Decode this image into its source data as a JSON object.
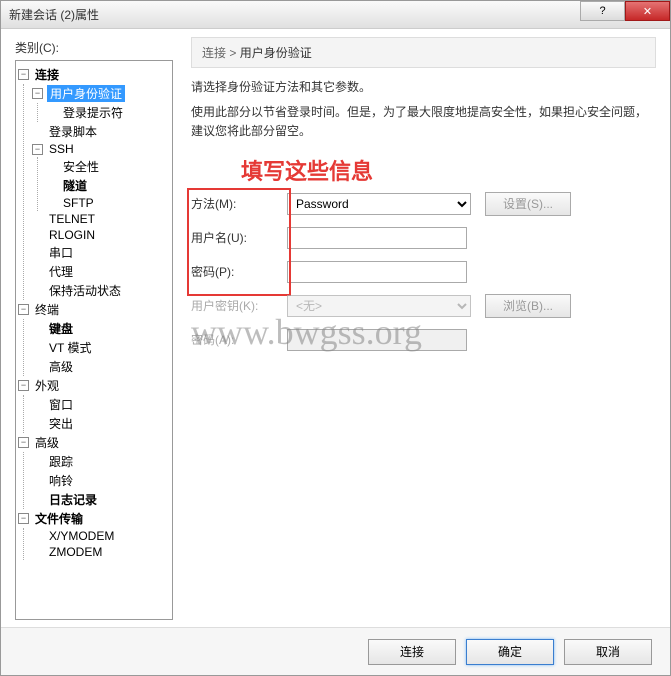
{
  "window": {
    "title": "新建会话 (2)属性"
  },
  "left": {
    "label": "类别(C):",
    "tree": {
      "connection": {
        "label": "连接",
        "auth": "用户身份验证",
        "login_prompt": "登录提示符",
        "login_script": "登录脚本",
        "ssh": {
          "label": "SSH",
          "security": "安全性",
          "tunnel": "隧道",
          "sftp": "SFTP"
        },
        "telnet": "TELNET",
        "rlogin": "RLOGIN",
        "serial": "串口",
        "proxy": "代理",
        "keepalive": "保持活动状态"
      },
      "terminal": {
        "label": "终端",
        "keyboard": "键盘",
        "vt": "VT 模式",
        "advanced": "高级"
      },
      "appearance": {
        "label": "外观",
        "window": "窗口",
        "highlight": "突出"
      },
      "advanced": {
        "label": "高级",
        "trace": "跟踪",
        "bell": "响铃",
        "log": "日志记录"
      },
      "transfer": {
        "label": "文件传输",
        "xymodem": "X/YMODEM",
        "zmodem": "ZMODEM"
      }
    }
  },
  "right": {
    "breadcrumb": {
      "root": "连接",
      "sep": ">",
      "current": "用户身份验证"
    },
    "desc1": "请选择身份验证方法和其它参数。",
    "desc2": "使用此部分以节省登录时间。但是，为了最大限度地提高安全性，如果担心安全问题，建议您将此部分留空。",
    "annotation": "填写这些信息",
    "form": {
      "method_label": "方法(M):",
      "method_value": "Password",
      "username_label": "用户名(U):",
      "password_label": "密码(P):",
      "userkey_label": "用户密钥(K):",
      "userkey_value": "<无>",
      "pass2_label": "密码(A):",
      "settings_btn": "设置(S)...",
      "browse_btn": "浏览(B)..."
    }
  },
  "footer": {
    "connect": "连接",
    "ok": "确定",
    "cancel": "取消"
  },
  "watermark": "www.bwgss.org"
}
